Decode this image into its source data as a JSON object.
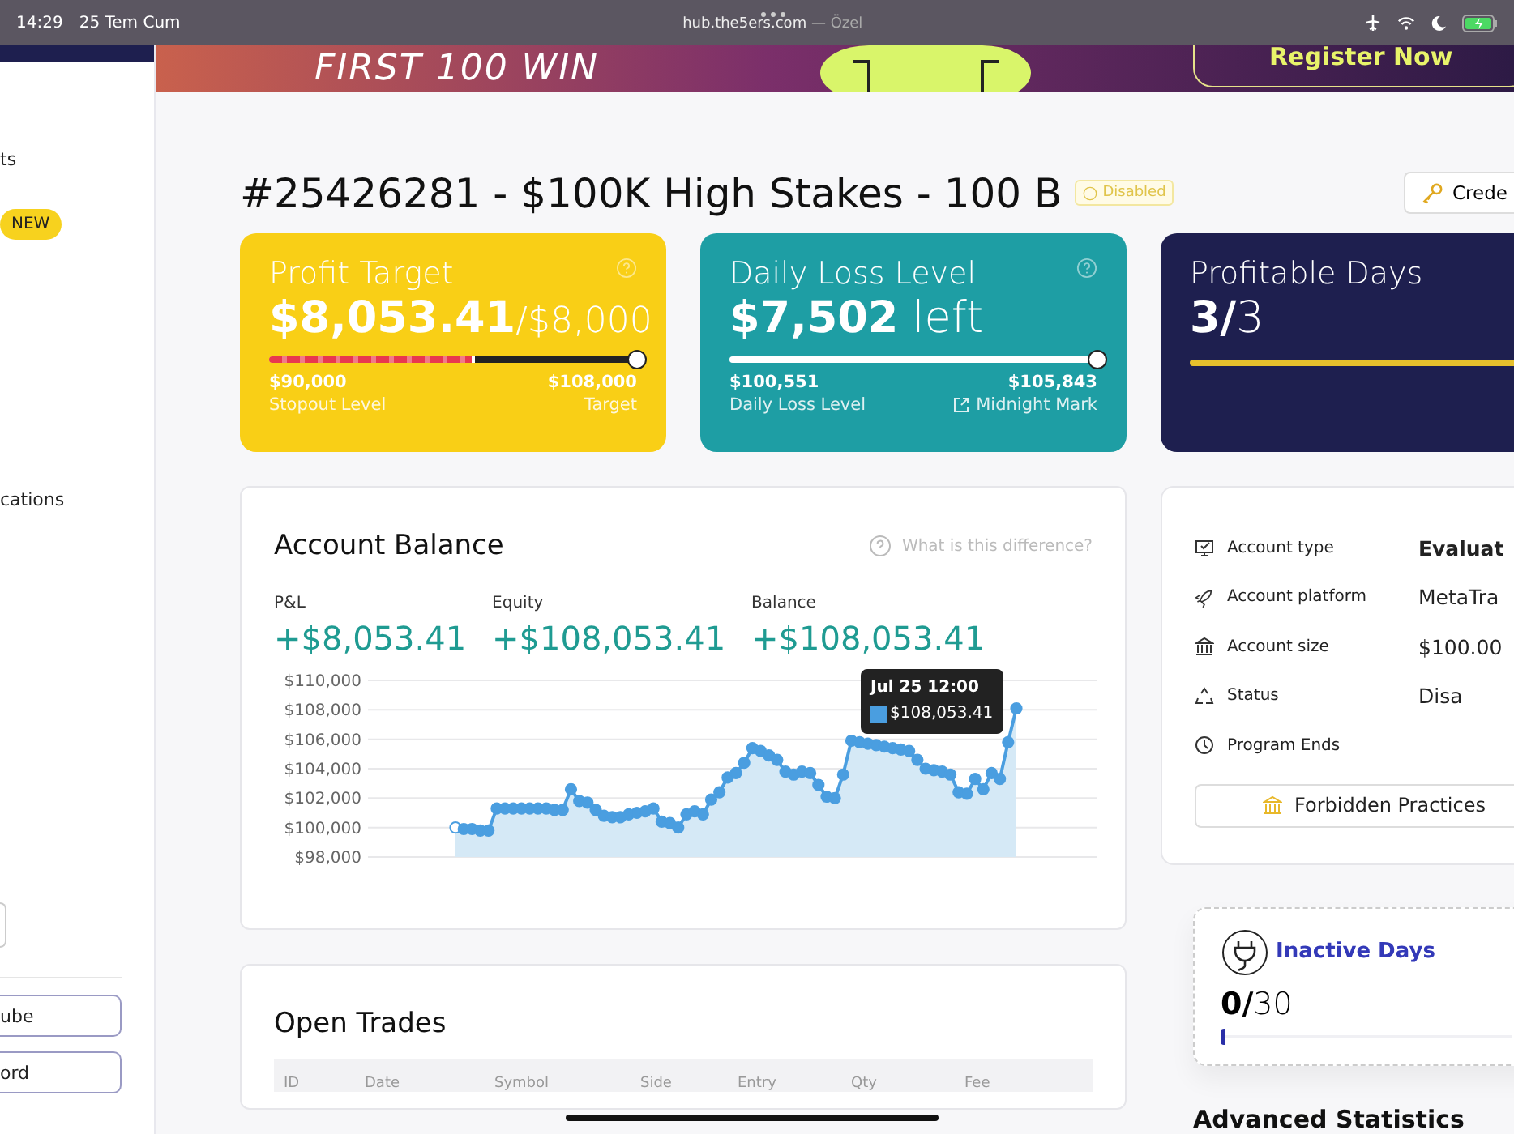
{
  "status_bar": {
    "time": "14:29",
    "date": "25 Tem Cum",
    "url": "hub.the5ers.com",
    "privacy": "— Özel"
  },
  "banner": {
    "headline": "FIRST 100 WIN",
    "button": "Register Now"
  },
  "sidebar": {
    "items": [
      {
        "label": "ts"
      },
      {
        "badge": "NEW"
      },
      {
        "label": "cations"
      }
    ],
    "buttons": [
      "ube",
      "ord"
    ]
  },
  "account": {
    "title": "#25426281 - $100K High Stakes - 100 B",
    "status_badge": "Disabled",
    "credentials_button": "Crede"
  },
  "cards": [
    {
      "kind": "profit",
      "title": "Profit Target",
      "value": "$8,053.41",
      "suffix": "/$8,000",
      "level": 1,
      "left_value": "$90,000",
      "left_label": "Stopout Level",
      "right_value": "$108,000",
      "right_label": "Target"
    },
    {
      "kind": "loss",
      "title": "Daily Loss Level",
      "value": "$7,502",
      "suffix": "left",
      "level": 1,
      "left_value": "$100,551",
      "left_label": "Daily Loss Level",
      "right_value": "$105,843",
      "right_label": "Midnight Mark"
    },
    {
      "kind": "days",
      "title": "Profitable Days",
      "value": "3/",
      "suffix": "3",
      "level": 1
    }
  ],
  "balance": {
    "title": "Account Balance",
    "help": "What is this difference?",
    "stats": [
      {
        "label": "P&L",
        "value": "+$8,053.41"
      },
      {
        "label": "Equity",
        "value": "+$108,053.41"
      },
      {
        "label": "Balance",
        "value": "+$108,053.41"
      }
    ],
    "tooltip": {
      "date": "Jul 25 12:00",
      "value": "$108,053.41"
    },
    "chart_data": {
      "type": "area",
      "grid": true,
      "ylim": [
        98000,
        110000
      ],
      "yticks": [
        {
          "value": 98000,
          "label": "$98,000"
        },
        {
          "value": 100000,
          "label": "$100,000"
        },
        {
          "value": 102000,
          "label": "$102,000"
        },
        {
          "value": 104000,
          "label": "$104,000"
        },
        {
          "value": 106000,
          "label": "$106,000"
        },
        {
          "value": 108000,
          "label": "$108,000"
        },
        {
          "value": 110000,
          "label": "$110,000"
        }
      ],
      "series": [
        {
          "color": "#4a9ee0",
          "values": [
            100000,
            99900,
            99900,
            99800,
            99800,
            101300,
            101300,
            101300,
            101300,
            101300,
            101300,
            101300,
            101200,
            101200,
            102600,
            101800,
            101700,
            101200,
            100800,
            100700,
            100700,
            100900,
            101000,
            101100,
            101300,
            100400,
            100300,
            100000,
            100900,
            101100,
            100900,
            101900,
            102400,
            103400,
            103700,
            104400,
            105400,
            105200,
            104900,
            104600,
            103800,
            103600,
            103800,
            103700,
            102900,
            102100,
            102000,
            103600,
            105900,
            105800,
            105700,
            105600,
            105500,
            105400,
            105300,
            105200,
            104600,
            104000,
            103900,
            103800,
            103600,
            102400,
            102300,
            103300,
            102600,
            103700,
            103300,
            105800,
            108100
          ]
        }
      ]
    }
  },
  "details": {
    "rows": [
      {
        "kind": "monitor",
        "label": "Account type",
        "value": "Evaluat"
      },
      {
        "kind": "rocket",
        "label": "Account platform",
        "value": "MetaTra"
      },
      {
        "kind": "bank",
        "label": "Account size",
        "value": "$100.00"
      },
      {
        "kind": "recycle",
        "label": "Status",
        "value": "Disa"
      },
      {
        "kind": "clock",
        "label": "Program Ends"
      }
    ],
    "button": "Forbidden Practices"
  },
  "inactive": {
    "title": "Inactive Days",
    "value": "0/",
    "suffix": "30",
    "level": 0
  },
  "advanced_title": "Advanced Statistics",
  "open_trades": {
    "title": "Open Trades",
    "columns": [
      "ID",
      "Date",
      "Symbol",
      "Side",
      "Entry",
      "Qty",
      "Fee"
    ]
  }
}
